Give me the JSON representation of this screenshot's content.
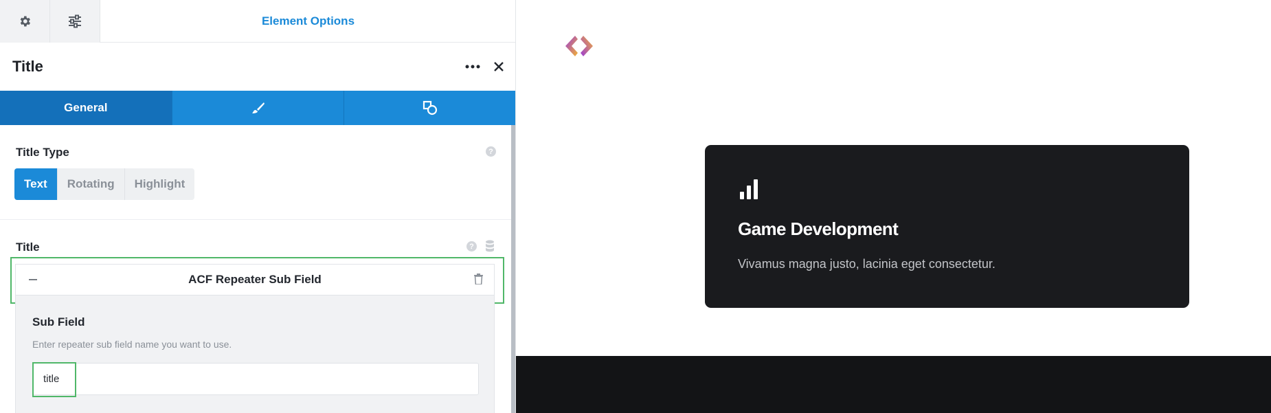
{
  "panel": {
    "header_title": "Element Options",
    "element_title": "Title",
    "tabs": [
      {
        "label": "General",
        "icon": "none"
      },
      {
        "label": "",
        "icon": "paintbrush-icon"
      },
      {
        "label": "",
        "icon": "shapes-icon"
      }
    ],
    "title_type": {
      "label": "Title Type",
      "options": [
        "Text",
        "Rotating",
        "Highlight"
      ],
      "selected": "Text"
    },
    "title_field": {
      "label": "Title",
      "dynamic_source": "ACF Repeater Sub Field"
    },
    "sub_field": {
      "label": "Sub Field",
      "hint": "Enter repeater sub field name you want to use.",
      "value": "title"
    }
  },
  "preview": {
    "card": {
      "title": "Game Development",
      "description": "Vivamus magna justo, lacinia eget consectetur."
    }
  },
  "colors": {
    "accent": "#1b8ad8",
    "highlight": "#4fb768",
    "card_bg": "#1a1b1e"
  }
}
